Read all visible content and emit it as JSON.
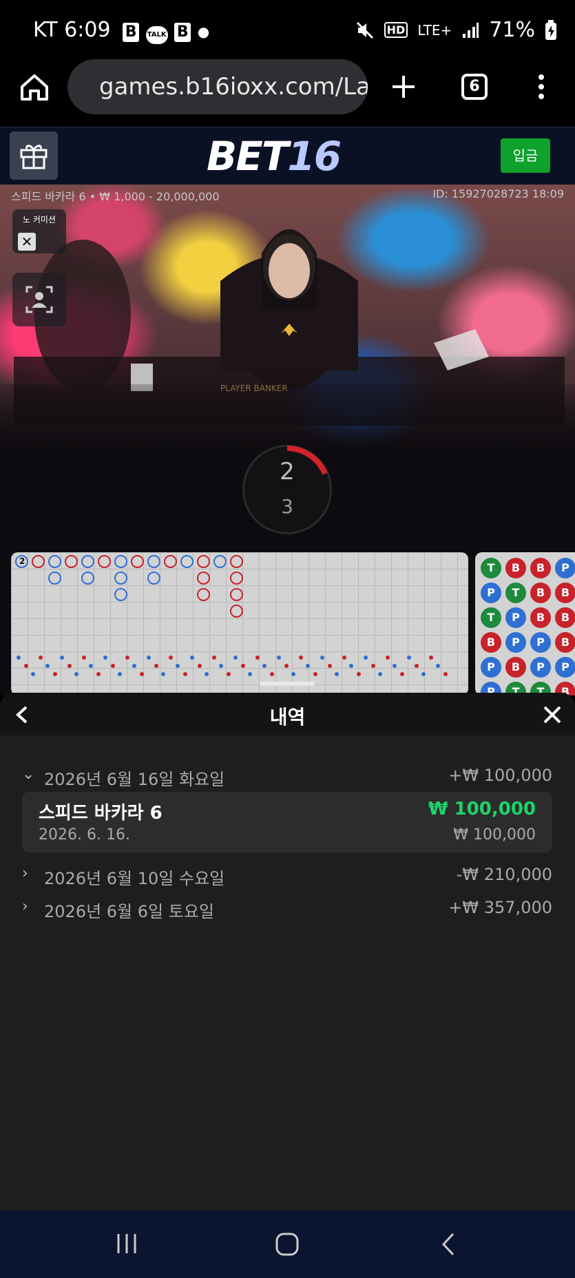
{
  "status_bar": {
    "carrier_time": "KT 6:09",
    "icons": [
      "b-app-icon",
      "kakaotalk-icon",
      "b-app-icon",
      "dot"
    ],
    "talk_label": "TALK",
    "hd_label": "HD",
    "network": "LTE+",
    "battery": "71%"
  },
  "browser": {
    "url": "games.b16ioxx.com/La",
    "tab_count": "6"
  },
  "site": {
    "logo_a": "BET",
    "logo_b": "16",
    "deposit_label": "입금"
  },
  "video": {
    "table_info": "스피드 바카라 6 • ₩ 1,000 - 20,000,000",
    "id_info": "ID: 15927028723 18:09",
    "no_commission_label": "노 커미션",
    "felt_label": "PLAYER   BANKER",
    "timer_top": "2",
    "timer_bottom": "3"
  },
  "roadmap": {
    "first_cell_label": "2",
    "bead_labels": {
      "tie": "T",
      "banker": "B",
      "player": "P"
    },
    "colors": {
      "banker": "#c8222a",
      "player": "#2f6fd1",
      "tie": "#1e8a3c"
    }
  },
  "history": {
    "title": "내역",
    "groups": [
      {
        "date": "2026년 6월 16일 화요일",
        "amount": "+₩ 100,000",
        "expanded": true
      },
      {
        "date": "2026년 6월 10일 수요일",
        "amount": "-₩ 210,000",
        "expanded": false
      },
      {
        "date": "2026년 6월 6일 토요일",
        "amount": "+₩ 357,000",
        "expanded": false
      }
    ],
    "entry": {
      "game": "스피드 바카라 6",
      "date": "2026. 6. 16.",
      "win": "₩ 100,000",
      "bet": "₩ 100,000"
    }
  }
}
